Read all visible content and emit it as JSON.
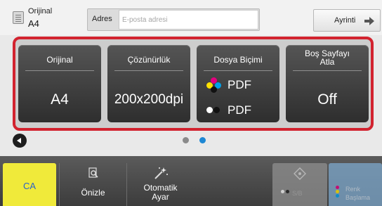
{
  "header": {
    "original": {
      "label": "Orijinal",
      "value": "A4",
      "icon": "document-icon"
    },
    "address": {
      "label": "Adres",
      "placeholder": "E-posta adresi",
      "value": ""
    },
    "detail_button": {
      "label": "Ayrinti",
      "icon": "arrow-right-icon"
    }
  },
  "settings": {
    "highlight_color": "#d2232f",
    "tiles": [
      {
        "label": "Orijinal",
        "value": "A4"
      },
      {
        "label": "Çözünürlük",
        "value": "200x200dpi"
      },
      {
        "label": "Dosya Biçimi",
        "color_format": "PDF",
        "mono_format": "PDF"
      },
      {
        "label_line1": "Boş Sayfayı",
        "label_line2": "Atla",
        "value": "Off"
      }
    ]
  },
  "pager": {
    "pages": 2,
    "current": 2,
    "back_icon": "back-arrow-icon"
  },
  "bottom_bar": {
    "ca": {
      "label": "CA",
      "color": "#f0ea3a"
    },
    "preview": {
      "label": "Önizle",
      "icon": "preview-icon"
    },
    "auto_adjust": {
      "label_line1": "Otomatik",
      "label_line2": "Ayar",
      "icon": "magic-wand-icon"
    },
    "start_bw": {
      "label": "S/B",
      "icon": "start-icon",
      "enabled": false
    },
    "start_color": {
      "label_line1": "Renk",
      "label_line2": "Başlama",
      "enabled": false
    }
  }
}
